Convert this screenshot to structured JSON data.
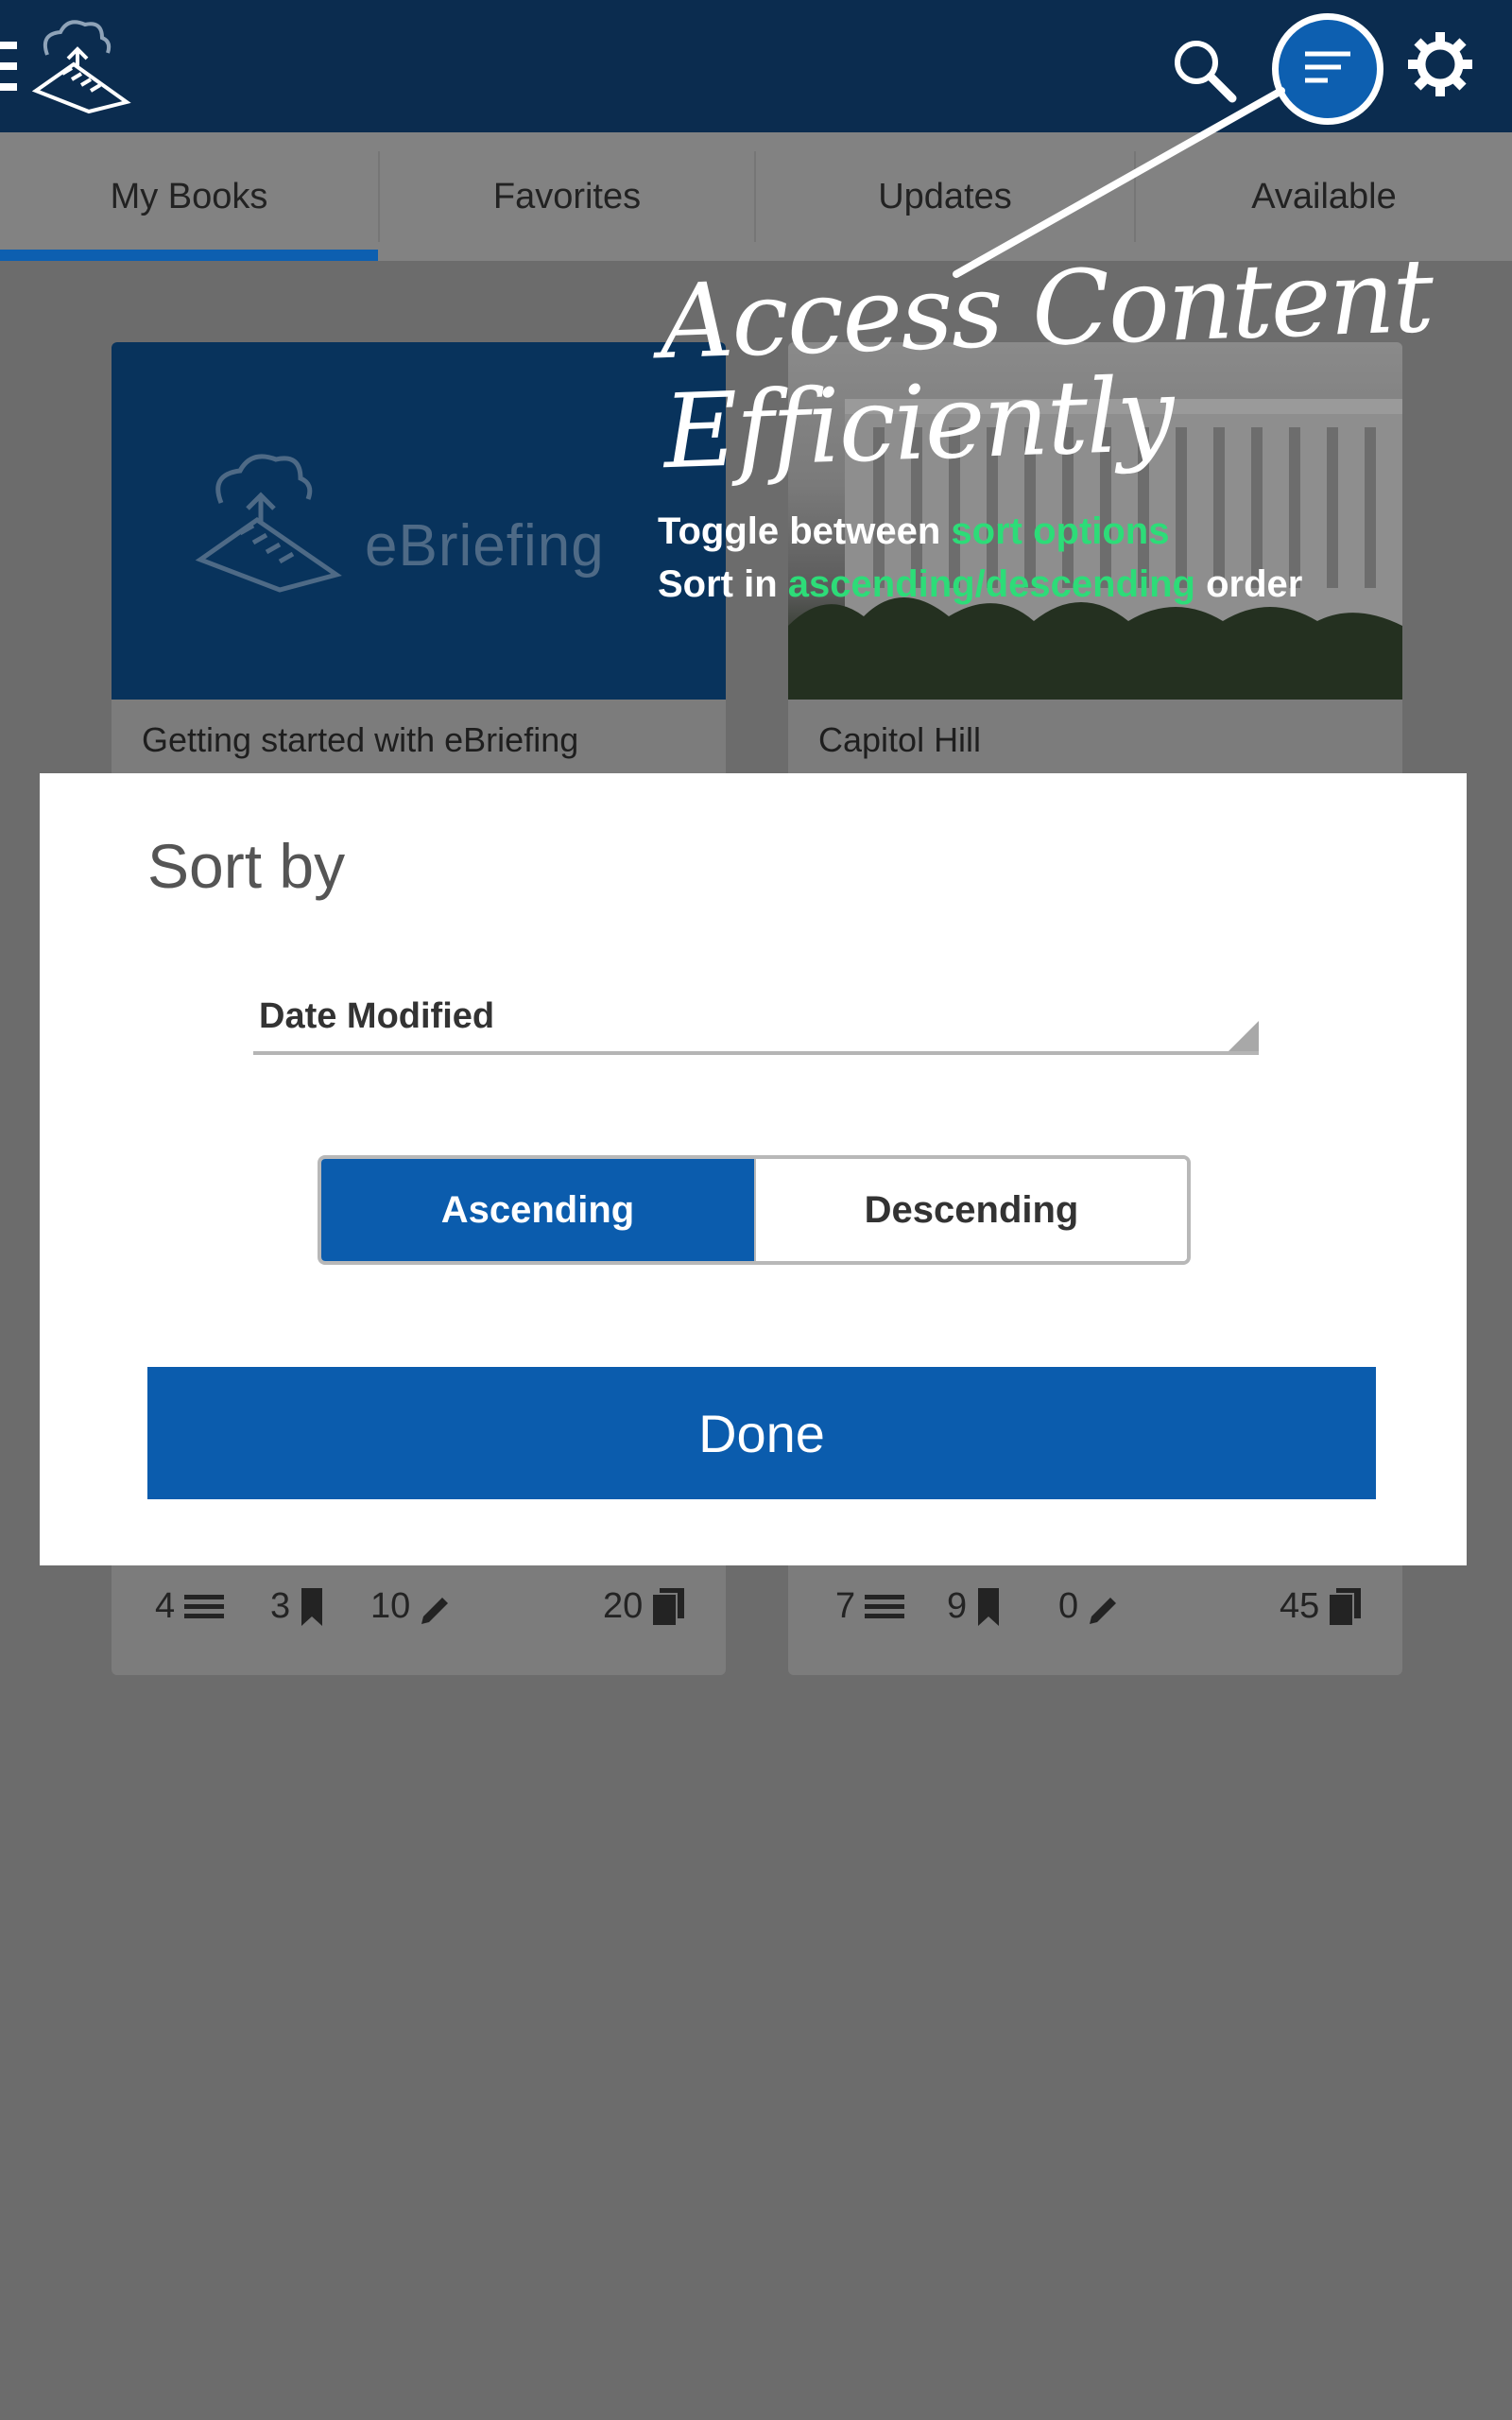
{
  "header": {
    "icons": [
      "menu-icon",
      "app-logo",
      "search-icon",
      "sort-icon",
      "settings-icon"
    ]
  },
  "tabs": [
    {
      "label": "My Books",
      "selected": true
    },
    {
      "label": "Favorites",
      "selected": false
    },
    {
      "label": "Updates",
      "selected": false
    },
    {
      "label": "Available",
      "selected": false
    }
  ],
  "overlay": {
    "headline_line1": "Access Content",
    "headline_line2": "Efficiently",
    "hint1_pre": "Toggle between ",
    "hint1_green": "sort options",
    "hint2_pre": "Sort in ",
    "hint2_green": "ascending/descending",
    "hint2_post": " order",
    "green_color": "#2ddc78"
  },
  "books": [
    {
      "cover_text": "eBriefing",
      "title": "Getting started with eBriefing",
      "chapters": "4",
      "bookmarks": "3",
      "notes": "10",
      "pages": "20"
    },
    {
      "title": "Capitol Hill",
      "chapters": "7",
      "bookmarks": "9",
      "notes": "0",
      "pages": "45"
    }
  ],
  "dialog": {
    "title": "Sort by",
    "sort_field": "Date Modified",
    "ascending_label": "Ascending",
    "descending_label": "Descending",
    "selected_order": "Ascending",
    "done_label": "Done"
  },
  "colors": {
    "app_bar": "#0b2c4f",
    "accent": "#0b5cad"
  }
}
